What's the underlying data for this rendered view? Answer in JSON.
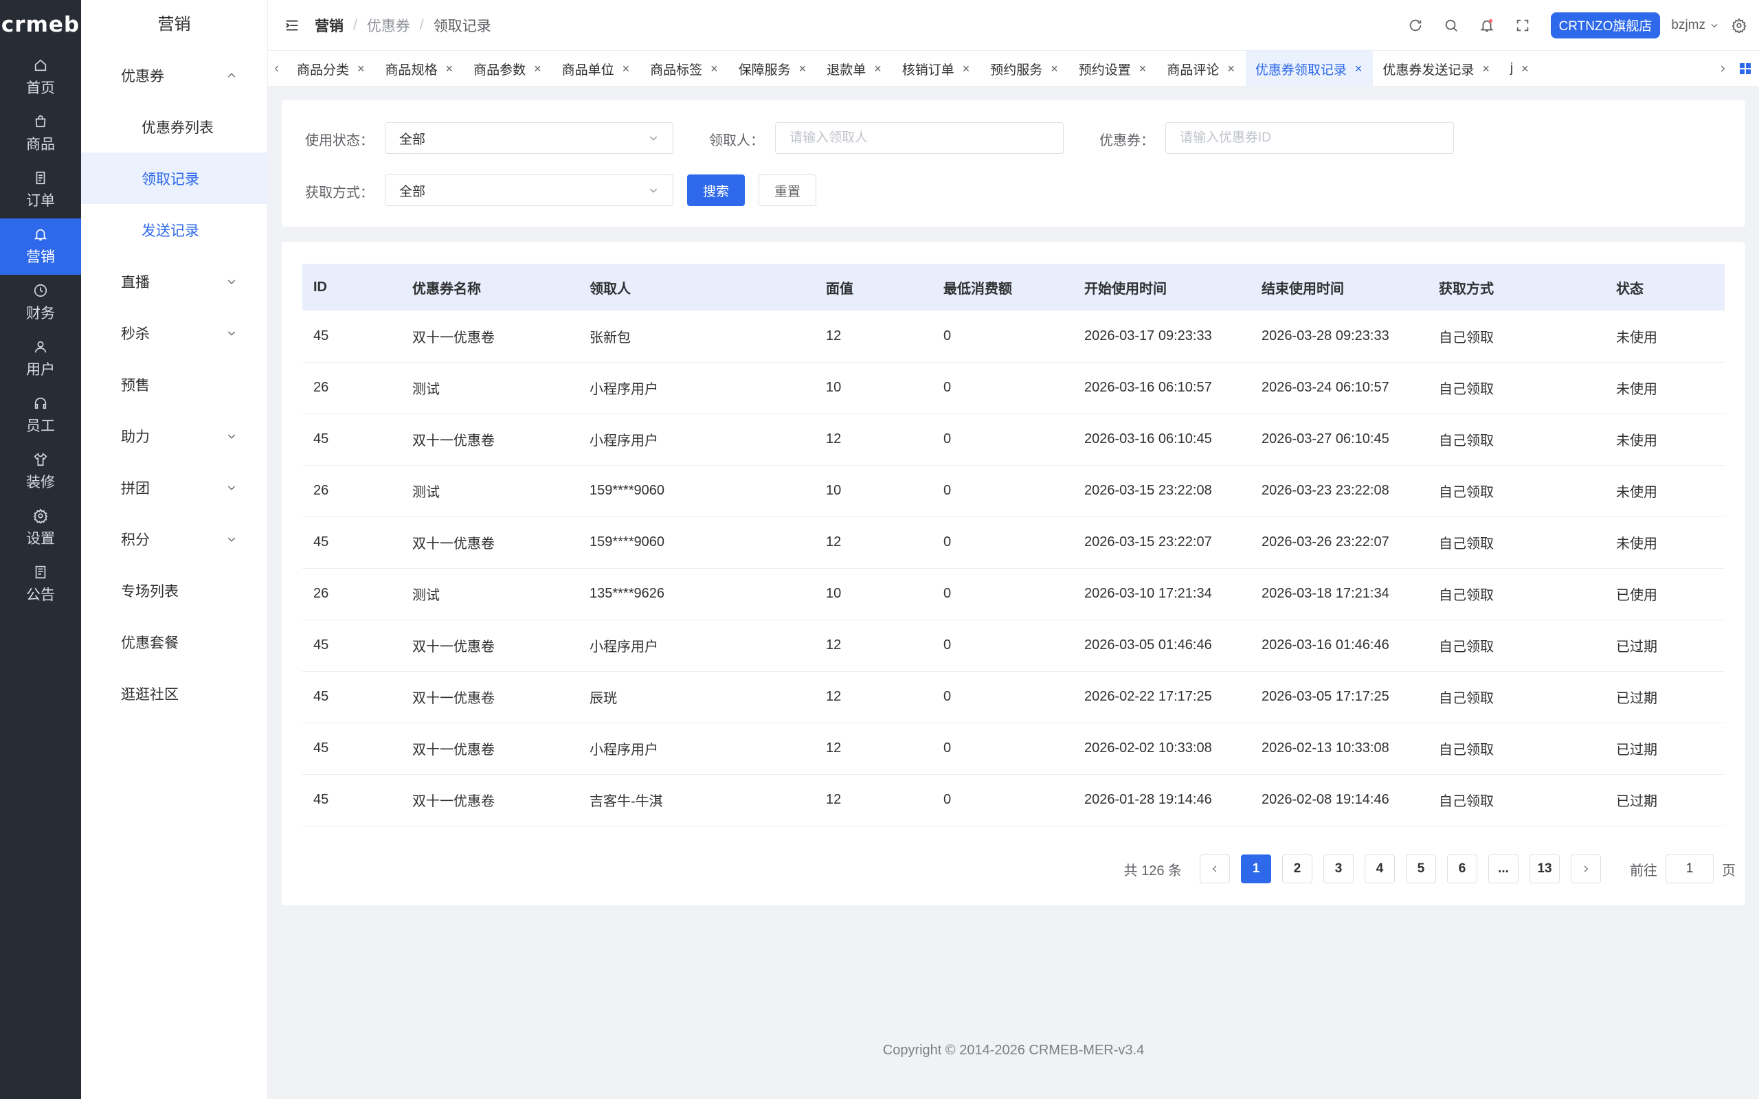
{
  "brand": {
    "logo_text": "crmeb"
  },
  "main_nav": [
    {
      "label": "首页",
      "icon": "home-icon"
    },
    {
      "label": "商品",
      "icon": "bag-icon"
    },
    {
      "label": "订单",
      "icon": "document-icon"
    },
    {
      "label": "营销",
      "icon": "bell-icon",
      "active": true
    },
    {
      "label": "财务",
      "icon": "clock-icon"
    },
    {
      "label": "用户",
      "icon": "user-icon"
    },
    {
      "label": "员工",
      "icon": "headset-icon"
    },
    {
      "label": "装修",
      "icon": "shirt-icon"
    },
    {
      "label": "设置",
      "icon": "gear-icon"
    },
    {
      "label": "公告",
      "icon": "notice-icon"
    }
  ],
  "sub_nav": {
    "title": "营销",
    "items": [
      {
        "label": "优惠券",
        "expand": "up"
      },
      {
        "label": "优惠券列表",
        "child": true
      },
      {
        "label": "领取记录",
        "child": true,
        "active": true
      },
      {
        "label": "发送记录",
        "child": true
      },
      {
        "label": "直播",
        "expand": "down"
      },
      {
        "label": "秒杀",
        "expand": "down"
      },
      {
        "label": "预售"
      },
      {
        "label": "助力",
        "expand": "down"
      },
      {
        "label": "拼团",
        "expand": "down"
      },
      {
        "label": "积分",
        "expand": "down"
      },
      {
        "label": "专场列表"
      },
      {
        "label": "优惠套餐"
      },
      {
        "label": "逛逛社区"
      }
    ]
  },
  "header": {
    "breadcrumb": [
      "营销",
      "优惠券",
      "领取记录"
    ],
    "shop_name": "CRTNZO旗舰店",
    "username": "bzjmz"
  },
  "tabs": [
    {
      "label": "商品分类"
    },
    {
      "label": "商品规格"
    },
    {
      "label": "商品参数"
    },
    {
      "label": "商品单位"
    },
    {
      "label": "商品标签"
    },
    {
      "label": "保障服务"
    },
    {
      "label": "退款单"
    },
    {
      "label": "核销订单"
    },
    {
      "label": "预约服务"
    },
    {
      "label": "预约设置"
    },
    {
      "label": "商品评论"
    },
    {
      "label": "优惠券领取记录",
      "active": true
    },
    {
      "label": "优惠券发送记录"
    },
    {
      "label": "j"
    }
  ],
  "filters": {
    "status_label": "使用状态：",
    "status_value": "全部",
    "receiver_label": "领取人：",
    "receiver_placeholder": "请输入领取人",
    "coupon_label": "优惠券：",
    "coupon_placeholder": "请输入优惠券ID",
    "method_label": "获取方式：",
    "method_value": "全部",
    "search_label": "搜索",
    "reset_label": "重置"
  },
  "table": {
    "columns": [
      "ID",
      "优惠券名称",
      "领取人",
      "面值",
      "最低消费额",
      "开始使用时间",
      "结束使用时间",
      "获取方式",
      "状态"
    ],
    "rows": [
      [
        "45",
        "双十一优惠卷",
        "张新包",
        "12",
        "0",
        "2026-03-17 09:23:33",
        "2026-03-28 09:23:33",
        "自己领取",
        "未使用"
      ],
      [
        "26",
        "测试",
        "小程序用户",
        "10",
        "0",
        "2026-03-16 06:10:57",
        "2026-03-24 06:10:57",
        "自己领取",
        "未使用"
      ],
      [
        "45",
        "双十一优惠卷",
        "小程序用户",
        "12",
        "0",
        "2026-03-16 06:10:45",
        "2026-03-27 06:10:45",
        "自己领取",
        "未使用"
      ],
      [
        "26",
        "测试",
        "159****9060",
        "10",
        "0",
        "2026-03-15 23:22:08",
        "2026-03-23 23:22:08",
        "自己领取",
        "未使用"
      ],
      [
        "45",
        "双十一优惠卷",
        "159****9060",
        "12",
        "0",
        "2026-03-15 23:22:07",
        "2026-03-26 23:22:07",
        "自己领取",
        "未使用"
      ],
      [
        "26",
        "测试",
        "135****9626",
        "10",
        "0",
        "2026-03-10 17:21:34",
        "2026-03-18 17:21:34",
        "自己领取",
        "已使用"
      ],
      [
        "45",
        "双十一优惠卷",
        "小程序用户",
        "12",
        "0",
        "2026-03-05 01:46:46",
        "2026-03-16 01:46:46",
        "自己领取",
        "已过期"
      ],
      [
        "45",
        "双十一优惠卷",
        "辰珖",
        "12",
        "0",
        "2026-02-22 17:17:25",
        "2026-03-05 17:17:25",
        "自己领取",
        "已过期"
      ],
      [
        "45",
        "双十一优惠卷",
        "小程序用户",
        "12",
        "0",
        "2026-02-02 10:33:08",
        "2026-02-13 10:33:08",
        "自己领取",
        "已过期"
      ],
      [
        "45",
        "双十一优惠卷",
        "吉客牛-牛淇",
        "12",
        "0",
        "2026-01-28 19:14:46",
        "2026-02-08 19:14:46",
        "自己领取",
        "已过期"
      ]
    ]
  },
  "pagination": {
    "total_text": "共 126 条",
    "pages": [
      "1",
      "2",
      "3",
      "4",
      "5",
      "6",
      "...",
      "13"
    ],
    "current": "1",
    "goto_label": "前往",
    "goto_value": "1",
    "page_suffix": "页"
  },
  "footer": {
    "copyright": "Copyright © 2014-2026 CRMEB-MER-v3.4"
  },
  "colors": {
    "accent": "#2d69ea",
    "sidebar_bg": "#282c34",
    "header_row_bg": "#e9eefd"
  }
}
